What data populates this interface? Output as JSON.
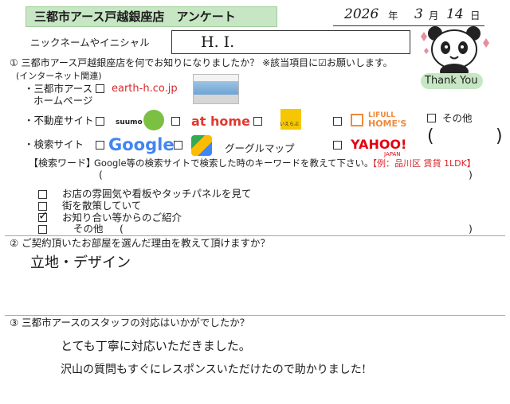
{
  "header": {
    "title": "三都市アース戸越銀座店　アンケート",
    "date": {
      "year": "2026",
      "year_unit": "年",
      "month": "3",
      "month_unit": "月",
      "day": "14",
      "day_unit": "日"
    }
  },
  "nickname": {
    "label": "ニックネームやイニシャル",
    "value": "H. I."
  },
  "thank_you": "Thank You",
  "q1": {
    "question": "① 三都市アース戸越銀座店を何でお知りになりましたか？ ※該当項目に☑お願いします。",
    "internet_heading": "(インターネット関連)",
    "homepage_label_1": "・三都市アース",
    "homepage_label_2": "ホームページ",
    "homepage_url": "earth-h.co.jp",
    "realestate_label": "・不動産サイト",
    "suumo": "suumo",
    "athome": "at home",
    "ieyasu": "いえらぶ",
    "lifull_1": "LIFULL",
    "lifull_2": "HOME'S",
    "other": "その他",
    "search_label": "・検索サイト",
    "google": "Google",
    "googlemap": "グーグルマップ",
    "yahoo": "YAHOO!",
    "yahoo_sub": "JAPAN",
    "keyword_label": "【検索ワード】",
    "keyword_instruction": "Google等の検索サイトで検索した時のキーワードを教えて下さい。",
    "keyword_example": "【例：品川区 賃貸 1LDK】",
    "open_paren": "(",
    "close_paren": ")",
    "options": [
      {
        "label": "お店の雰囲気や看板やタッチパネルを見て",
        "checked": false
      },
      {
        "label": "街を散策していて",
        "checked": false
      },
      {
        "label": "お知り合い等からのご紹介",
        "checked": true
      },
      {
        "label": "その他",
        "checked": false
      }
    ]
  },
  "q2": {
    "question": "② ご契約頂いたお部屋を選んだ理由を教えて頂けますか？",
    "answer": "立地・デザイン"
  },
  "q3": {
    "question": "③ 三都市アースのスタッフの対応はいかがでしたか？",
    "answer_line1": "とても丁寧に対応いただきました。",
    "answer_line2": "沢山の質問もすぐにレスポンスいただけたので助かりました!"
  },
  "colors": {
    "banner": "#c7e6c4",
    "accent_green": "#7dc575",
    "red": "#d9262c"
  }
}
